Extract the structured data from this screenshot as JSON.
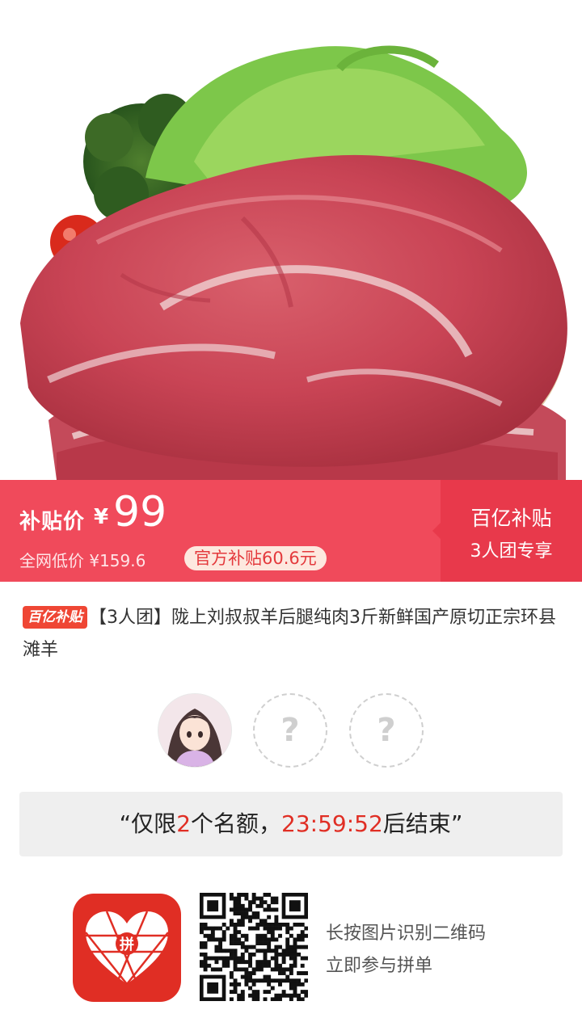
{
  "product_image": {
    "icon": "meat-product-photo"
  },
  "price_banner": {
    "label": "补贴价",
    "currency": "¥",
    "price": "99",
    "original_price": "全网低价 ¥159.6",
    "subsidy": "官方补贴60.6元",
    "right_title": "百亿补贴",
    "right_subtitle": "3人团专享",
    "colors": {
      "left": "#f04a5b",
      "right": "#e8394b"
    }
  },
  "product": {
    "tag": "百亿补贴",
    "title": "【3人团】陇上刘叔叔羊后腿纯肉3斤新鲜国产原切正宗环县滩羊"
  },
  "group": {
    "filled_members": 1,
    "empty_placeholder": "?"
  },
  "countdown": {
    "open_quote": "“",
    "prefix": "仅限",
    "count": "2",
    "middle": "个名额，",
    "time": "23:59:52",
    "suffix": "后结束",
    "close_quote": "”"
  },
  "footer": {
    "logo_char": "拼",
    "line1": "长按图片识别二维码",
    "line2": "立即参与拼单"
  }
}
